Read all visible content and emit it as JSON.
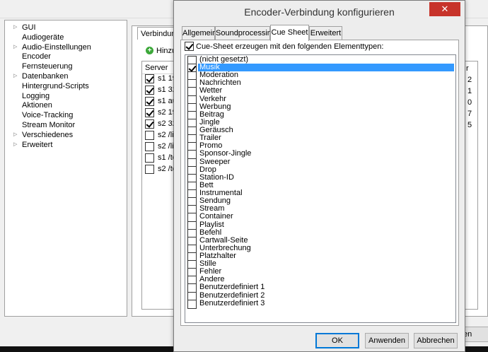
{
  "main": {
    "tree_items": [
      {
        "label": "GUI",
        "expander": true
      },
      {
        "label": "Audiogeräte",
        "expander": false
      },
      {
        "label": "Audio-Einstellungen",
        "expander": true
      },
      {
        "label": "Encoder",
        "expander": false
      },
      {
        "label": "Fernsteuerung",
        "expander": false
      },
      {
        "label": "Datenbanken",
        "expander": true
      },
      {
        "label": "Hintergrund-Scripts",
        "expander": false
      },
      {
        "label": "Logging",
        "expander": false
      },
      {
        "label": "Aktionen",
        "expander": false
      },
      {
        "label": "Voice-Tracking",
        "expander": false
      },
      {
        "label": "Stream Monitor",
        "expander": false
      },
      {
        "label": "Verschiedenes",
        "expander": true
      },
      {
        "label": "Erweitert",
        "expander": true
      }
    ],
    "content_tab": "Verbindung",
    "add_label": "Hinzu",
    "server_header": "Server",
    "servers": [
      {
        "text": "s1 19",
        "checked": true
      },
      {
        "text": "s1 32",
        "checked": true
      },
      {
        "text": "s1 au",
        "checked": true
      },
      {
        "text": "s2 19",
        "checked": true
      },
      {
        "text": "s2 32",
        "checked": true
      },
      {
        "text": "s2 /liv",
        "checked": false
      },
      {
        "text": "s2 /liv",
        "checked": false
      },
      {
        "text": "s1 /te",
        "checked": false
      },
      {
        "text": "s2 /te",
        "checked": false
      }
    ],
    "right_header": "r",
    "right_values": [
      "2",
      "1",
      "0",
      "7",
      "5"
    ],
    "bottom_button_fragment": "en"
  },
  "dialog": {
    "title": "Encoder-Verbindung konfigurieren",
    "close_glyph": "✕",
    "tabs": [
      {
        "label": "Allgemein",
        "active": false
      },
      {
        "label": "Soundprocessing",
        "active": false
      },
      {
        "label": "Cue Sheet",
        "active": true
      },
      {
        "label": "Erweitert",
        "active": false
      }
    ],
    "enable_label": "Cue-Sheet erzeugen mit den folgenden Elementtypen:",
    "enable_checked": true,
    "element_types": [
      {
        "label": "(nicht gesetzt)",
        "checked": false,
        "selected": false
      },
      {
        "label": "Musik",
        "checked": true,
        "selected": true
      },
      {
        "label": "Moderation",
        "checked": false,
        "selected": false
      },
      {
        "label": "Nachrichten",
        "checked": false,
        "selected": false
      },
      {
        "label": "Wetter",
        "checked": false,
        "selected": false
      },
      {
        "label": "Verkehr",
        "checked": false,
        "selected": false
      },
      {
        "label": "Werbung",
        "checked": false,
        "selected": false
      },
      {
        "label": "Beitrag",
        "checked": false,
        "selected": false
      },
      {
        "label": "Jingle",
        "checked": false,
        "selected": false
      },
      {
        "label": "Geräusch",
        "checked": false,
        "selected": false
      },
      {
        "label": "Trailer",
        "checked": false,
        "selected": false
      },
      {
        "label": "Promo",
        "checked": false,
        "selected": false
      },
      {
        "label": "Sponsor-Jingle",
        "checked": false,
        "selected": false
      },
      {
        "label": "Sweeper",
        "checked": false,
        "selected": false
      },
      {
        "label": "Drop",
        "checked": false,
        "selected": false
      },
      {
        "label": "Station-ID",
        "checked": false,
        "selected": false
      },
      {
        "label": "Bett",
        "checked": false,
        "selected": false
      },
      {
        "label": "Instrumental",
        "checked": false,
        "selected": false
      },
      {
        "label": "Sendung",
        "checked": false,
        "selected": false
      },
      {
        "label": "Stream",
        "checked": false,
        "selected": false
      },
      {
        "label": "Container",
        "checked": false,
        "selected": false
      },
      {
        "label": "Playlist",
        "checked": false,
        "selected": false
      },
      {
        "label": "Befehl",
        "checked": false,
        "selected": false
      },
      {
        "label": "Cartwall-Seite",
        "checked": false,
        "selected": false
      },
      {
        "label": "Unterbrechung",
        "checked": false,
        "selected": false
      },
      {
        "label": "Platzhalter",
        "checked": false,
        "selected": false
      },
      {
        "label": "Stille",
        "checked": false,
        "selected": false
      },
      {
        "label": "Fehler",
        "checked": false,
        "selected": false
      },
      {
        "label": "Andere",
        "checked": false,
        "selected": false
      },
      {
        "label": "Benutzerdefiniert 1",
        "checked": false,
        "selected": false
      },
      {
        "label": "Benutzerdefiniert 2",
        "checked": false,
        "selected": false
      },
      {
        "label": "Benutzerdefiniert 3",
        "checked": false,
        "selected": false
      }
    ],
    "ok_label": "OK",
    "apply_label": "Anwenden",
    "cancel_label": "Abbrechen"
  },
  "colors": {
    "selection": "#3399ff",
    "close_button": "#c7332a",
    "add_icon": "#3ca83a"
  }
}
